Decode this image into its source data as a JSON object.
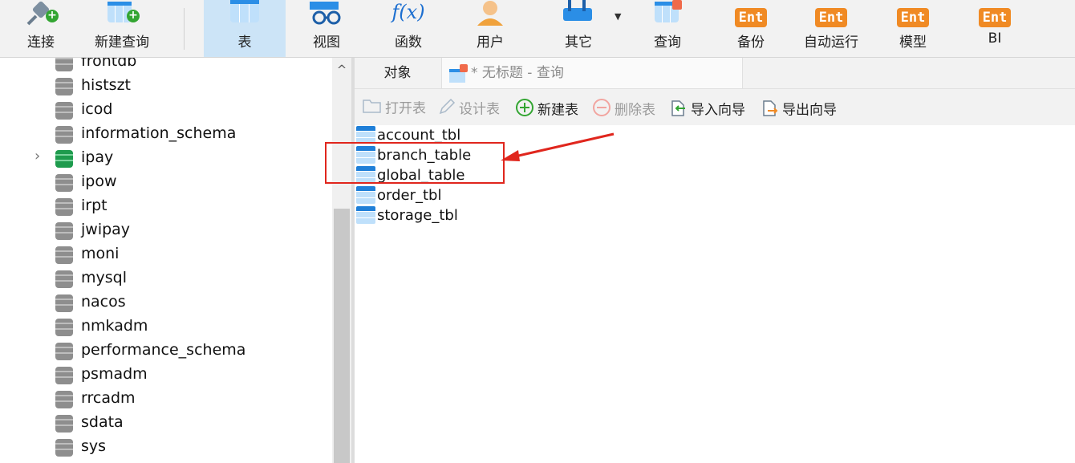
{
  "toolbar": {
    "items": [
      {
        "label": "连接",
        "icon": "plug-connect-icon"
      },
      {
        "label": "新建查询",
        "icon": "new-query-icon"
      },
      {
        "label": "表",
        "icon": "table-icon",
        "selected": true
      },
      {
        "label": "视图",
        "icon": "view-glasses-icon"
      },
      {
        "label": "函数",
        "icon": "function-fx-icon"
      },
      {
        "label": "用户",
        "icon": "user-icon"
      },
      {
        "label": "其它",
        "icon": "other-tools-icon"
      },
      {
        "label": "查询",
        "icon": "query-icon"
      },
      {
        "label": "备份",
        "icon": "backup-ent-icon"
      },
      {
        "label": "自动运行",
        "icon": "automation-ent-icon"
      },
      {
        "label": "模型",
        "icon": "model-ent-icon"
      },
      {
        "label": "BI",
        "icon": "bi-ent-icon"
      }
    ],
    "ent_badge": "Ent",
    "fx_text": "f(x)"
  },
  "tree": {
    "databases": [
      {
        "name": "frontdb",
        "active": false
      },
      {
        "name": "histszt",
        "active": false
      },
      {
        "name": "icod",
        "active": false
      },
      {
        "name": "information_schema",
        "active": false
      },
      {
        "name": "ipay",
        "active": true,
        "expandable": true
      },
      {
        "name": "ipow",
        "active": false
      },
      {
        "name": "irpt",
        "active": false
      },
      {
        "name": "jwipay",
        "active": false
      },
      {
        "name": "moni",
        "active": false
      },
      {
        "name": "mysql",
        "active": false
      },
      {
        "name": "nacos",
        "active": false
      },
      {
        "name": "nmkadm",
        "active": false
      },
      {
        "name": "performance_schema",
        "active": false
      },
      {
        "name": "psmadm",
        "active": false
      },
      {
        "name": "rrcadm",
        "active": false
      },
      {
        "name": "sdata",
        "active": false
      },
      {
        "name": "sys",
        "active": false
      }
    ],
    "expand_glyph": "›",
    "scroll_up_glyph": "^"
  },
  "tabs": {
    "objects": "对象",
    "query": "* 无标题 - 查询"
  },
  "object_toolbar": {
    "open_table": "打开表",
    "design_table": "设计表",
    "new_table": "新建表",
    "delete_table": "删除表",
    "import_wizard": "导入向导",
    "export_wizard": "导出向导"
  },
  "tables": [
    "account_tbl",
    "branch_table",
    "global_table",
    "order_tbl",
    "storage_tbl"
  ],
  "colors": {
    "selected_toolbar": "#cce4f7",
    "annotation_red": "#e0261d",
    "ent_orange": "#f08a24",
    "active_db_green": "#1e9b4d"
  }
}
